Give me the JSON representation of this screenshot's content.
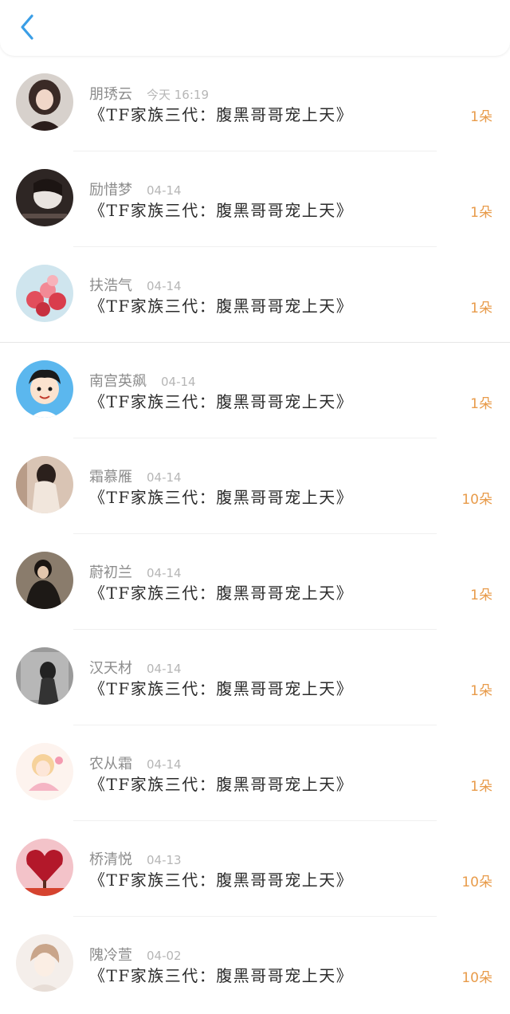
{
  "header": {
    "back_icon": "chevron-left-icon",
    "accent": "#3a9ee6"
  },
  "gift_color": "#e89b4a",
  "items": [
    {
      "name": "朋琇云",
      "time": "今天 16:19",
      "title": "《TF家族三代：腹黑哥哥宠上天》",
      "gift": "1朵"
    },
    {
      "name": "励惜梦",
      "time": "04-14",
      "title": "《TF家族三代：腹黑哥哥宠上天》",
      "gift": "1朵"
    },
    {
      "name": "扶浩气",
      "time": "04-14",
      "title": "《TF家族三代：腹黑哥哥宠上天》",
      "gift": "1朵"
    },
    {
      "name": "南宫英飙",
      "time": "04-14",
      "title": "《TF家族三代：腹黑哥哥宠上天》",
      "gift": "1朵"
    },
    {
      "name": "霜慕雁",
      "time": "04-14",
      "title": "《TF家族三代：腹黑哥哥宠上天》",
      "gift": "10朵"
    },
    {
      "name": "蔚初兰",
      "time": "04-14",
      "title": "《TF家族三代：腹黑哥哥宠上天》",
      "gift": "1朵"
    },
    {
      "name": "汉天材",
      "time": "04-14",
      "title": "《TF家族三代：腹黑哥哥宠上天》",
      "gift": "1朵"
    },
    {
      "name": "农从霜",
      "time": "04-14",
      "title": "《TF家族三代：腹黑哥哥宠上天》",
      "gift": "1朵"
    },
    {
      "name": "桥清悦",
      "time": "04-13",
      "title": "《TF家族三代：腹黑哥哥宠上天》",
      "gift": "10朵"
    },
    {
      "name": "隗冷萱",
      "time": "04-02",
      "title": "《TF家族三代：腹黑哥哥宠上天》",
      "gift": "10朵"
    }
  ]
}
